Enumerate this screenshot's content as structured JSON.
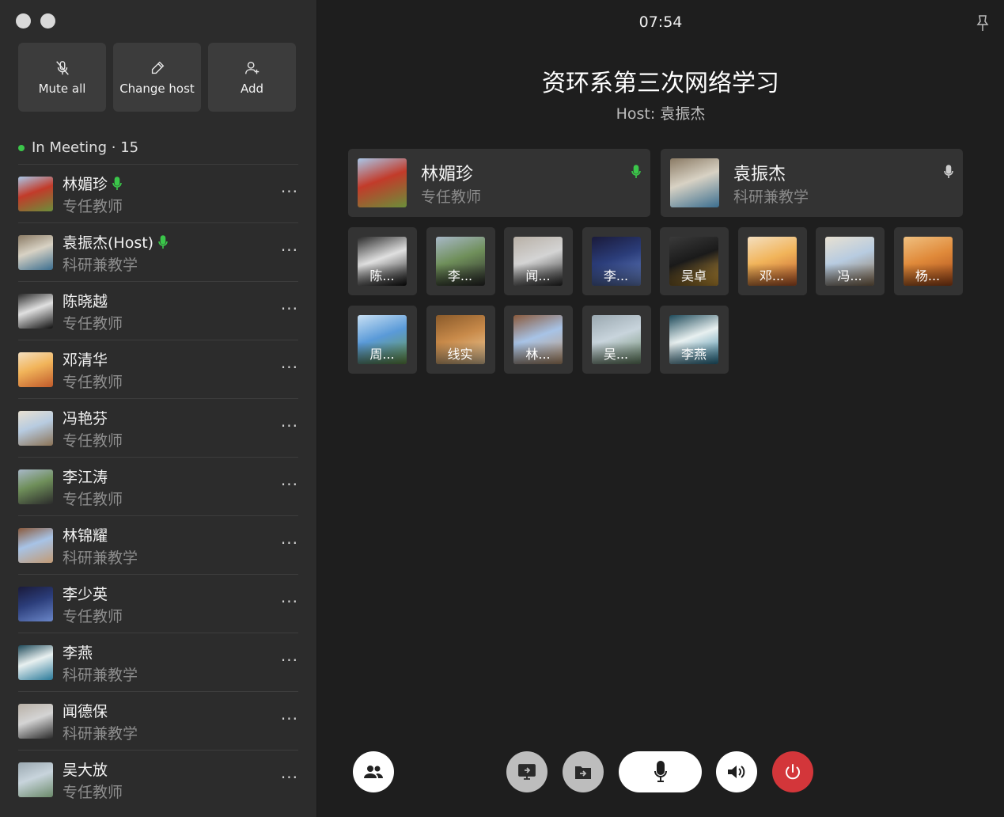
{
  "sidebar": {
    "actions": [
      {
        "label": "Mute all",
        "icon": "mic-off-icon"
      },
      {
        "label": "Change host",
        "icon": "pen-icon"
      },
      {
        "label": "Add",
        "icon": "add-user-icon"
      }
    ],
    "in_meeting_label": "In Meeting",
    "in_meeting_sep": " · ",
    "in_meeting_count": "15",
    "members": [
      {
        "name": "林媚珍",
        "role": "专任教师",
        "mic": true,
        "colors": [
          "#c23b2a",
          "#6b8f3a",
          "#a8c7e8"
        ]
      },
      {
        "name": "袁振杰(Host)",
        "role": "科研兼教学",
        "mic": true,
        "colors": [
          "#d8d2c4",
          "#3b6e8f",
          "#8a7a64"
        ]
      },
      {
        "name": "陈晓越",
        "role": "专任教师",
        "mic": false,
        "colors": [
          "#e0e0e0",
          "#111111",
          "#2a2a2a"
        ]
      },
      {
        "name": "邓清华",
        "role": "专任教师",
        "mic": false,
        "colors": [
          "#f1b45a",
          "#c05a2a",
          "#f4dfbf"
        ]
      },
      {
        "name": "冯艳芬",
        "role": "专任教师",
        "mic": false,
        "colors": [
          "#b7cbe0",
          "#8b7356",
          "#e8e1d2"
        ]
      },
      {
        "name": "李江涛",
        "role": "专任教师",
        "mic": false,
        "colors": [
          "#6f8f5a",
          "#2b2b2b",
          "#a8b8c8"
        ]
      },
      {
        "name": "林锦耀",
        "role": "科研兼教学",
        "mic": false,
        "colors": [
          "#a7c3e6",
          "#c29a74",
          "#8a5a3c"
        ]
      },
      {
        "name": "李少英",
        "role": "专任教师",
        "mic": false,
        "colors": [
          "#2b3d7a",
          "#6a86c8",
          "#1a1a3a"
        ]
      },
      {
        "name": "李燕",
        "role": "科研兼教学",
        "mic": false,
        "colors": [
          "#e8f0f0",
          "#2a7a9a",
          "#1e4a5a"
        ]
      },
      {
        "name": "闻德保",
        "role": "科研兼教学",
        "mic": false,
        "colors": [
          "#d4d4d4",
          "#2a2a2a",
          "#b8b0a6"
        ]
      },
      {
        "name": "吴大放",
        "role": "专任教师",
        "mic": false,
        "colors": [
          "#c8d4dc",
          "#6b8a6a",
          "#9aa8b0"
        ]
      }
    ]
  },
  "main": {
    "clock": "07:54",
    "title": "资环系第三次网络学习",
    "host_label": "Host:",
    "host_name": "袁振杰",
    "speakers": [
      {
        "name": "林媚珍",
        "role": "专任教师",
        "mic_color": "#3bc64a",
        "colors": [
          "#c23b2a",
          "#6b8f3a",
          "#a8c7e8"
        ]
      },
      {
        "name": "袁振杰",
        "role": "科研兼教学",
        "mic_color": "#cccccc",
        "colors": [
          "#d8d2c4",
          "#3b6e8f",
          "#8a7a64"
        ]
      }
    ],
    "tiles": [
      {
        "label": "陈...",
        "colors": [
          "#e0e0e0",
          "#111111",
          "#2a2a2a"
        ]
      },
      {
        "label": "李...",
        "colors": [
          "#6f8f5a",
          "#2b2b2b",
          "#a8b8c8"
        ]
      },
      {
        "label": "闻...",
        "colors": [
          "#d4d4d4",
          "#2a2a2a",
          "#b8b0a6"
        ]
      },
      {
        "label": "李...",
        "colors": [
          "#2b3d7a",
          "#6a86c8",
          "#1a1a3a"
        ]
      },
      {
        "label": "吴卓",
        "colors": [
          "#1a1a1a",
          "#d8a23a",
          "#3a3a3a"
        ]
      },
      {
        "label": "邓...",
        "colors": [
          "#f1b45a",
          "#c05a2a",
          "#f4dfbf"
        ]
      },
      {
        "label": "冯...",
        "colors": [
          "#b7cbe0",
          "#8b7356",
          "#e8e1d2"
        ]
      },
      {
        "label": "杨...",
        "colors": [
          "#e08a3a",
          "#a84a1a",
          "#f0c080"
        ]
      },
      {
        "label": "周...",
        "colors": [
          "#5a9ad8",
          "#6a9a4a",
          "#c8e0f4"
        ]
      },
      {
        "label": "线实",
        "colors": [
          "#c88a4a",
          "#f4d4a4",
          "#8a5a2a"
        ]
      },
      {
        "label": "林...",
        "colors": [
          "#a7c3e6",
          "#c29a74",
          "#8a5a3c"
        ]
      },
      {
        "label": "吴...",
        "colors": [
          "#c8d4dc",
          "#6b8a6a",
          "#9aa8b0"
        ]
      },
      {
        "label": "李燕",
        "colors": [
          "#e8f0f0",
          "#2a7a9a",
          "#1e4a5a"
        ]
      }
    ]
  },
  "controls": {
    "participants_icon": "participants-icon",
    "screen_share_icon": "screen-share-icon",
    "file_share_icon": "file-share-icon",
    "mic_icon": "microphone-icon",
    "speaker_icon": "speaker-icon",
    "end_icon": "power-icon",
    "end_color": "#d3363a"
  }
}
